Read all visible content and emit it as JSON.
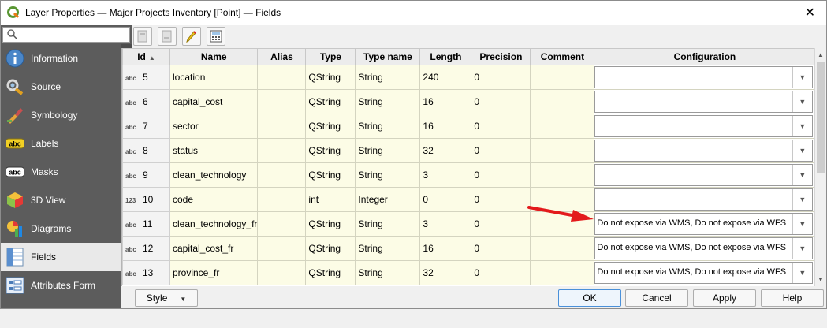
{
  "window": {
    "title": "Layer Properties — Major Projects Inventory [Point] — Fields",
    "close_glyph": "✕"
  },
  "search": {
    "placeholder": "",
    "value": ""
  },
  "nav": {
    "items": [
      {
        "label": "Information",
        "icon": "information-icon"
      },
      {
        "label": "Source",
        "icon": "source-icon"
      },
      {
        "label": "Symbology",
        "icon": "symbology-icon"
      },
      {
        "label": "Labels",
        "icon": "labels-icon",
        "badge": "abc"
      },
      {
        "label": "Masks",
        "icon": "masks-icon",
        "badge": "abc"
      },
      {
        "label": "3D View",
        "icon": "3d-view-icon"
      },
      {
        "label": "Diagrams",
        "icon": "diagrams-icon"
      },
      {
        "label": "Fields",
        "icon": "fields-icon",
        "active": true
      },
      {
        "label": "Attributes Form",
        "icon": "attributes-form-icon"
      }
    ]
  },
  "toolbar": {
    "buttons": [
      "new-field-icon",
      "delete-field-icon",
      "edit-mode-pencil-icon",
      "field-calculator-icon"
    ]
  },
  "table": {
    "columns": [
      "Id",
      "Name",
      "Alias",
      "Type",
      "Type name",
      "Length",
      "Precision",
      "Comment",
      "Configuration"
    ],
    "sort_indicator": "▲",
    "rows": [
      {
        "type_icon": "abc",
        "id": "5",
        "name": "location",
        "alias": "",
        "type": "QString",
        "type_name": "String",
        "length": "240",
        "precision": "0",
        "comment": "",
        "configuration": ""
      },
      {
        "type_icon": "abc",
        "id": "6",
        "name": "capital_cost",
        "alias": "",
        "type": "QString",
        "type_name": "String",
        "length": "16",
        "precision": "0",
        "comment": "",
        "configuration": ""
      },
      {
        "type_icon": "abc",
        "id": "7",
        "name": "sector",
        "alias": "",
        "type": "QString",
        "type_name": "String",
        "length": "16",
        "precision": "0",
        "comment": "",
        "configuration": ""
      },
      {
        "type_icon": "abc",
        "id": "8",
        "name": "status",
        "alias": "",
        "type": "QString",
        "type_name": "String",
        "length": "32",
        "precision": "0",
        "comment": "",
        "configuration": ""
      },
      {
        "type_icon": "abc",
        "id": "9",
        "name": "clean_technology",
        "alias": "",
        "type": "QString",
        "type_name": "String",
        "length": "3",
        "precision": "0",
        "comment": "",
        "configuration": ""
      },
      {
        "type_icon": "123",
        "id": "10",
        "name": "code",
        "alias": "",
        "type": "int",
        "type_name": "Integer",
        "length": "0",
        "precision": "0",
        "comment": "",
        "configuration": ""
      },
      {
        "type_icon": "abc",
        "id": "11",
        "name": "clean_technology_fr",
        "alias": "",
        "type": "QString",
        "type_name": "String",
        "length": "3",
        "precision": "0",
        "comment": "",
        "configuration": "Do not expose via WMS, Do not expose via WFS"
      },
      {
        "type_icon": "abc",
        "id": "12",
        "name": "capital_cost_fr",
        "alias": "",
        "type": "QString",
        "type_name": "String",
        "length": "16",
        "precision": "0",
        "comment": "",
        "configuration": "Do not expose via WMS, Do not expose via WFS"
      },
      {
        "type_icon": "abc",
        "id": "13",
        "name": "province_fr",
        "alias": "",
        "type": "QString",
        "type_name": "String",
        "length": "32",
        "precision": "0",
        "comment": "",
        "configuration": "Do not expose via WMS, Do not expose via WFS"
      }
    ]
  },
  "annotation": {
    "arrow_color": "#e31a1c"
  },
  "footer": {
    "style_label": "Style",
    "ok_label": "OK",
    "cancel_label": "Cancel",
    "apply_label": "Apply",
    "help_label": "Help"
  },
  "colors": {
    "sidebar_bg": "#5c5c5c",
    "row_bg": "#fcfce6",
    "accent": "#4a90d9"
  }
}
